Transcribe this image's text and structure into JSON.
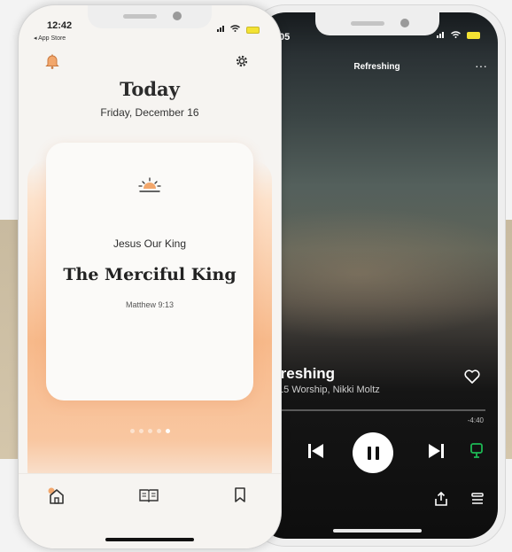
{
  "devotional_app": {
    "status_bar": {
      "time": "12:42",
      "back_label": "◂ App Store"
    },
    "header": {
      "title": "Today",
      "date": "Friday, December 16"
    },
    "card": {
      "series": "Jesus Our King",
      "title": "The Merciful King",
      "reference": "Matthew 9:13"
    },
    "pager": {
      "count": 5,
      "active_index": 4
    },
    "icons": {
      "bell": "bell-icon",
      "settings": "gear-icon",
      "sunrise": "sunrise-icon",
      "home": "home-icon",
      "read": "open-book-icon",
      "saved": "bookmark-icon"
    },
    "colors": {
      "accent": "#f2a76c",
      "background": "#f6f4f1",
      "text": "#2b2b2b"
    }
  },
  "music_player": {
    "status_bar": {
      "time": "05"
    },
    "header": {
      "title": "Refreshing",
      "more": "···"
    },
    "track": {
      "title": "freshing",
      "artists": "t15 Worship, Nikki Moltz"
    },
    "time_remaining": "-4:40",
    "progress": 0.0,
    "icons": {
      "heart": "heart-icon",
      "previous": "skip-previous-icon",
      "pause": "pause-icon",
      "next": "skip-next-icon",
      "device": "device-connect-icon",
      "share": "share-icon",
      "queue": "queue-icon"
    },
    "colors": {
      "accent": "#1db954"
    }
  }
}
